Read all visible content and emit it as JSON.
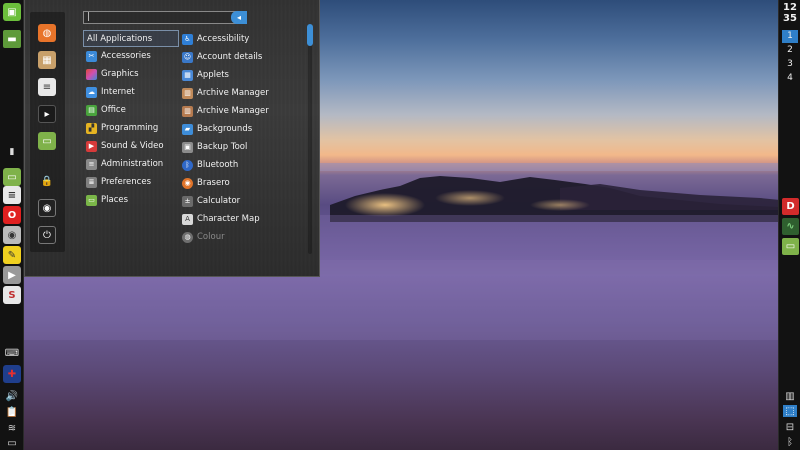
{
  "clock": {
    "hours": "12",
    "minutes": "35"
  },
  "workspaces": [
    "1",
    "2",
    "3",
    "4"
  ],
  "search": {
    "value": "|",
    "placeholder": ""
  },
  "categories": [
    {
      "label": "All Applications",
      "icon": "none",
      "color": ""
    },
    {
      "label": "Accessories",
      "icon": "scissors-icon",
      "color": "#3b8ad8"
    },
    {
      "label": "Graphics",
      "icon": "palette-icon",
      "color": "#d04fb0"
    },
    {
      "label": "Internet",
      "icon": "cloud-icon",
      "color": "#3f8fe0"
    },
    {
      "label": "Office",
      "icon": "document-icon",
      "color": "#49a33d"
    },
    {
      "label": "Programming",
      "icon": "chart-icon",
      "color": "#e6b422"
    },
    {
      "label": "Sound & Video",
      "icon": "play-icon",
      "color": "#d63a3a"
    },
    {
      "label": "Administration",
      "icon": "settings-icon",
      "color": "#8a8a8a"
    },
    {
      "label": "Preferences",
      "icon": "sliders-icon",
      "color": "#7f7f7f"
    },
    {
      "label": "Places",
      "icon": "folder-icon",
      "color": "#7ab648"
    }
  ],
  "apps": [
    {
      "label": "Accessibility",
      "icon": "accessibility-icon",
      "color": "#2f7fd6",
      "faded": false
    },
    {
      "label": "Account details",
      "icon": "user-icon",
      "color": "#3a78c8",
      "faded": false
    },
    {
      "label": "Applets",
      "icon": "applets-icon",
      "color": "#4a89d6",
      "faded": false
    },
    {
      "label": "Archive Manager",
      "icon": "archive-icon",
      "color": "#c08a5a",
      "faded": false
    },
    {
      "label": "Archive Manager",
      "icon": "archive-icon",
      "color": "#b57a4f",
      "faded": false
    },
    {
      "label": "Backgrounds",
      "icon": "backgrounds-icon",
      "color": "#3e8dd9",
      "faded": false
    },
    {
      "label": "Backup Tool",
      "icon": "backup-icon",
      "color": "#8c8c8c",
      "faded": false
    },
    {
      "label": "Bluetooth",
      "icon": "bluetooth-icon",
      "color": "#2f68c8",
      "faded": false
    },
    {
      "label": "Brasero",
      "icon": "disc-icon",
      "color": "#e0742a",
      "faded": false
    },
    {
      "label": "Calculator",
      "icon": "calculator-icon",
      "color": "#6a6a6a",
      "faded": false
    },
    {
      "label": "Character Map",
      "icon": "character-map-icon",
      "color": "#9a9a9a",
      "faded": false
    },
    {
      "label": "Colour",
      "icon": "colour-icon",
      "color": "#6f6f6f",
      "faded": true
    }
  ]
}
